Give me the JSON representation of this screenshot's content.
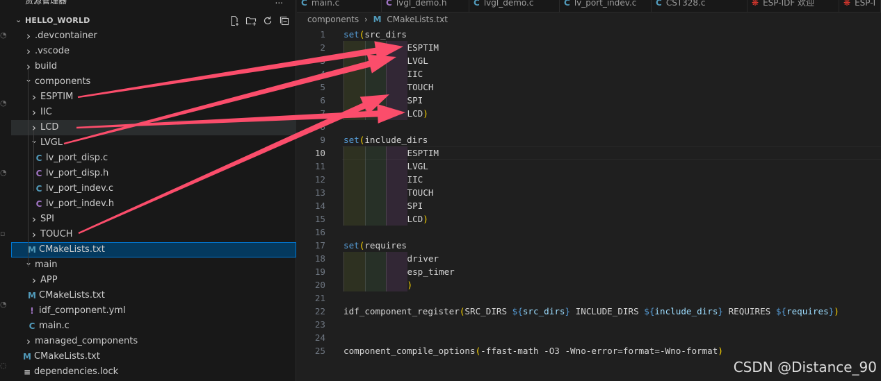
{
  "colors": {
    "arrow": "#fb4d6b",
    "c_icon": "#519aba",
    "h_icon": "#a074c4",
    "cmake_icon": "#519aba",
    "yml_icon": "#a074c4",
    "esp_icon": "#e5392f"
  },
  "explorer": {
    "title": "资源管理器",
    "more": "...",
    "workspace": "HELLO_WORLD",
    "actions": [
      {
        "icon": "new-file-icon"
      },
      {
        "icon": "new-folder-icon"
      },
      {
        "icon": "refresh-icon"
      },
      {
        "icon": "collapse-all-icon"
      }
    ],
    "tree": [
      {
        "label": ".devcontainer",
        "indent": 0,
        "twisty": "closed",
        "icon": "folder-icon"
      },
      {
        "label": ".vscode",
        "indent": 0,
        "twisty": "closed",
        "icon": "folder-icon"
      },
      {
        "label": "build",
        "indent": 0,
        "twisty": "closed",
        "icon": "folder-icon"
      },
      {
        "label": "components",
        "indent": 0,
        "twisty": "open",
        "icon": "folder-icon"
      },
      {
        "label": "ESPTIM",
        "indent": 1,
        "twisty": "closed",
        "icon": "folder-icon"
      },
      {
        "label": "IIC",
        "indent": 1,
        "twisty": "closed",
        "icon": "folder-icon"
      },
      {
        "label": "LCD",
        "indent": 1,
        "twisty": "closed",
        "icon": "folder-icon",
        "state": "hover"
      },
      {
        "label": "LVGL",
        "indent": 1,
        "twisty": "open",
        "icon": "folder-icon"
      },
      {
        "label": "lv_port_disp.c",
        "indent": 2,
        "twisty": "none",
        "icon": "c-file-icon",
        "glyph": "C",
        "color": "#519aba"
      },
      {
        "label": "lv_port_disp.h",
        "indent": 2,
        "twisty": "none",
        "icon": "h-file-icon",
        "glyph": "C",
        "color": "#a074c4"
      },
      {
        "label": "lv_port_indev.c",
        "indent": 2,
        "twisty": "none",
        "icon": "c-file-icon",
        "glyph": "C",
        "color": "#519aba"
      },
      {
        "label": "lv_port_indev.h",
        "indent": 2,
        "twisty": "none",
        "icon": "h-file-icon",
        "glyph": "C",
        "color": "#a074c4"
      },
      {
        "label": "SPI",
        "indent": 1,
        "twisty": "closed",
        "icon": "folder-icon"
      },
      {
        "label": "TOUCH",
        "indent": 1,
        "twisty": "closed",
        "icon": "folder-icon"
      },
      {
        "label": "CMakeLists.txt",
        "indent": 1,
        "twisty": "none",
        "icon": "cmake-file-icon",
        "glyph": "M",
        "color": "#519aba",
        "state": "selected"
      },
      {
        "label": "main",
        "indent": 0,
        "twisty": "open",
        "icon": "folder-icon"
      },
      {
        "label": "APP",
        "indent": 1,
        "twisty": "closed",
        "icon": "folder-icon"
      },
      {
        "label": "CMakeLists.txt",
        "indent": 1,
        "twisty": "none",
        "icon": "cmake-file-icon",
        "glyph": "M",
        "color": "#519aba"
      },
      {
        "label": "idf_component.yml",
        "indent": 1,
        "twisty": "none",
        "icon": "yml-file-icon",
        "glyph": "!",
        "color": "#a074c4"
      },
      {
        "label": "main.c",
        "indent": 1,
        "twisty": "none",
        "icon": "c-file-icon",
        "glyph": "C",
        "color": "#519aba"
      },
      {
        "label": "managed_components",
        "indent": 0,
        "twisty": "closed",
        "icon": "folder-icon"
      },
      {
        "label": "CMakeLists.txt",
        "indent": 0,
        "twisty": "none",
        "icon": "cmake-file-icon",
        "glyph": "M",
        "color": "#519aba"
      },
      {
        "label": "dependencies.lock",
        "indent": 0,
        "twisty": "none",
        "icon": "lines-file-icon",
        "glyph": "≡",
        "color": "#cccccc"
      }
    ]
  },
  "editor": {
    "tabs": [
      {
        "label": "main.c",
        "icon": "c-file-icon",
        "glyph": "C",
        "color": "#519aba"
      },
      {
        "label": "lvgl_demo.h",
        "icon": "h-file-icon",
        "glyph": "C",
        "color": "#a074c4"
      },
      {
        "label": "lvgl_demo.c",
        "icon": "c-file-icon",
        "glyph": "C",
        "color": "#519aba"
      },
      {
        "label": "lv_port_indev.c",
        "icon": "c-file-icon",
        "glyph": "C",
        "color": "#519aba"
      },
      {
        "label": "CST328.c",
        "icon": "c-file-icon",
        "glyph": "C",
        "color": "#519aba"
      },
      {
        "label": "ESP-IDF 欢迎",
        "icon": "esp-idf-icon",
        "glyph": "❋",
        "color": "#e5392f"
      },
      {
        "label": "ESP-I",
        "icon": "esp-idf-icon",
        "glyph": "❋",
        "color": "#e5392f"
      }
    ],
    "breadcrumb": {
      "folder": "components",
      "separator": "›",
      "file_icon": "M",
      "file": "CMakeLists.txt"
    },
    "active_line": 10,
    "lines": [
      {
        "n": "1",
        "tokens": [
          [
            "set",
            "tk-fn"
          ],
          [
            "(",
            "tk-p1"
          ],
          [
            "src_dirs",
            "tk-op"
          ]
        ]
      },
      {
        "n": "2",
        "indent": 3,
        "tokens": [
          [
            "ESPTIM",
            "tk-op"
          ]
        ]
      },
      {
        "n": "3",
        "indent": 3,
        "tokens": [
          [
            "LVGL",
            "tk-op"
          ]
        ]
      },
      {
        "n": "4",
        "indent": 3,
        "tokens": [
          [
            "IIC",
            "tk-op"
          ]
        ]
      },
      {
        "n": "5",
        "indent": 3,
        "tokens": [
          [
            "TOUCH",
            "tk-op"
          ]
        ]
      },
      {
        "n": "6",
        "indent": 3,
        "tokens": [
          [
            "SPI",
            "tk-op"
          ]
        ]
      },
      {
        "n": "7",
        "indent": 3,
        "tokens": [
          [
            "LCD",
            "tk-op"
          ],
          [
            ")",
            "tk-p1"
          ]
        ]
      },
      {
        "n": "8",
        "indent": 0,
        "tokens": []
      },
      {
        "n": "9",
        "tokens": [
          [
            "set",
            "tk-fn"
          ],
          [
            "(",
            "tk-p1"
          ],
          [
            "include_dirs",
            "tk-op"
          ]
        ]
      },
      {
        "n": "10",
        "indent": 3,
        "tokens": [
          [
            "ESPTIM",
            "tk-op"
          ]
        ]
      },
      {
        "n": "11",
        "indent": 3,
        "tokens": [
          [
            "LVGL",
            "tk-op"
          ]
        ]
      },
      {
        "n": "12",
        "indent": 3,
        "tokens": [
          [
            "IIC",
            "tk-op"
          ]
        ]
      },
      {
        "n": "13",
        "indent": 3,
        "tokens": [
          [
            "TOUCH",
            "tk-op"
          ]
        ]
      },
      {
        "n": "14",
        "indent": 3,
        "tokens": [
          [
            "SPI",
            "tk-op"
          ]
        ]
      },
      {
        "n": "15",
        "indent": 3,
        "tokens": [
          [
            "LCD",
            "tk-op"
          ],
          [
            ")",
            "tk-p1"
          ]
        ]
      },
      {
        "n": "16",
        "indent": 0,
        "tokens": []
      },
      {
        "n": "17",
        "tokens": [
          [
            "set",
            "tk-fn"
          ],
          [
            "(",
            "tk-p1"
          ],
          [
            "requires",
            "tk-op"
          ]
        ]
      },
      {
        "n": "18",
        "indent": 3,
        "tokens": [
          [
            "driver",
            "tk-op"
          ]
        ]
      },
      {
        "n": "19",
        "indent": 3,
        "tokens": [
          [
            "esp_timer",
            "tk-op"
          ]
        ]
      },
      {
        "n": "20",
        "indent": 3,
        "tokens": [
          [
            ")",
            "tk-p1"
          ]
        ]
      },
      {
        "n": "21",
        "indent": 0,
        "tokens": []
      },
      {
        "n": "22",
        "tokens": [
          [
            "idf_component_register",
            "tk-op"
          ],
          [
            "(",
            "tk-p1"
          ],
          [
            "SRC_DIRS ",
            "tk-op"
          ],
          [
            "${",
            "tk-fn"
          ],
          [
            "src_dirs",
            "tk-var"
          ],
          [
            "}",
            "tk-fn"
          ],
          [
            " INCLUDE_DIRS ",
            "tk-op"
          ],
          [
            "${",
            "tk-fn"
          ],
          [
            "include_dirs",
            "tk-var"
          ],
          [
            "}",
            "tk-fn"
          ],
          [
            " REQUIRES ",
            "tk-op"
          ],
          [
            "${",
            "tk-fn"
          ],
          [
            "requires",
            "tk-var"
          ],
          [
            "}",
            "tk-fn"
          ],
          [
            ")",
            "tk-p1"
          ]
        ]
      },
      {
        "n": "23",
        "indent": 0,
        "tokens": []
      },
      {
        "n": "24",
        "indent": 0,
        "tokens": []
      },
      {
        "n": "25",
        "tokens": [
          [
            "component_compile_options",
            "tk-op"
          ],
          [
            "(",
            "tk-p1"
          ],
          [
            "-ffast-math -O3 -Wno-error=format=-Wno-format",
            "tk-op"
          ],
          [
            ")",
            "tk-p1"
          ]
        ]
      }
    ]
  },
  "watermark": "CSDN @Distance_90"
}
